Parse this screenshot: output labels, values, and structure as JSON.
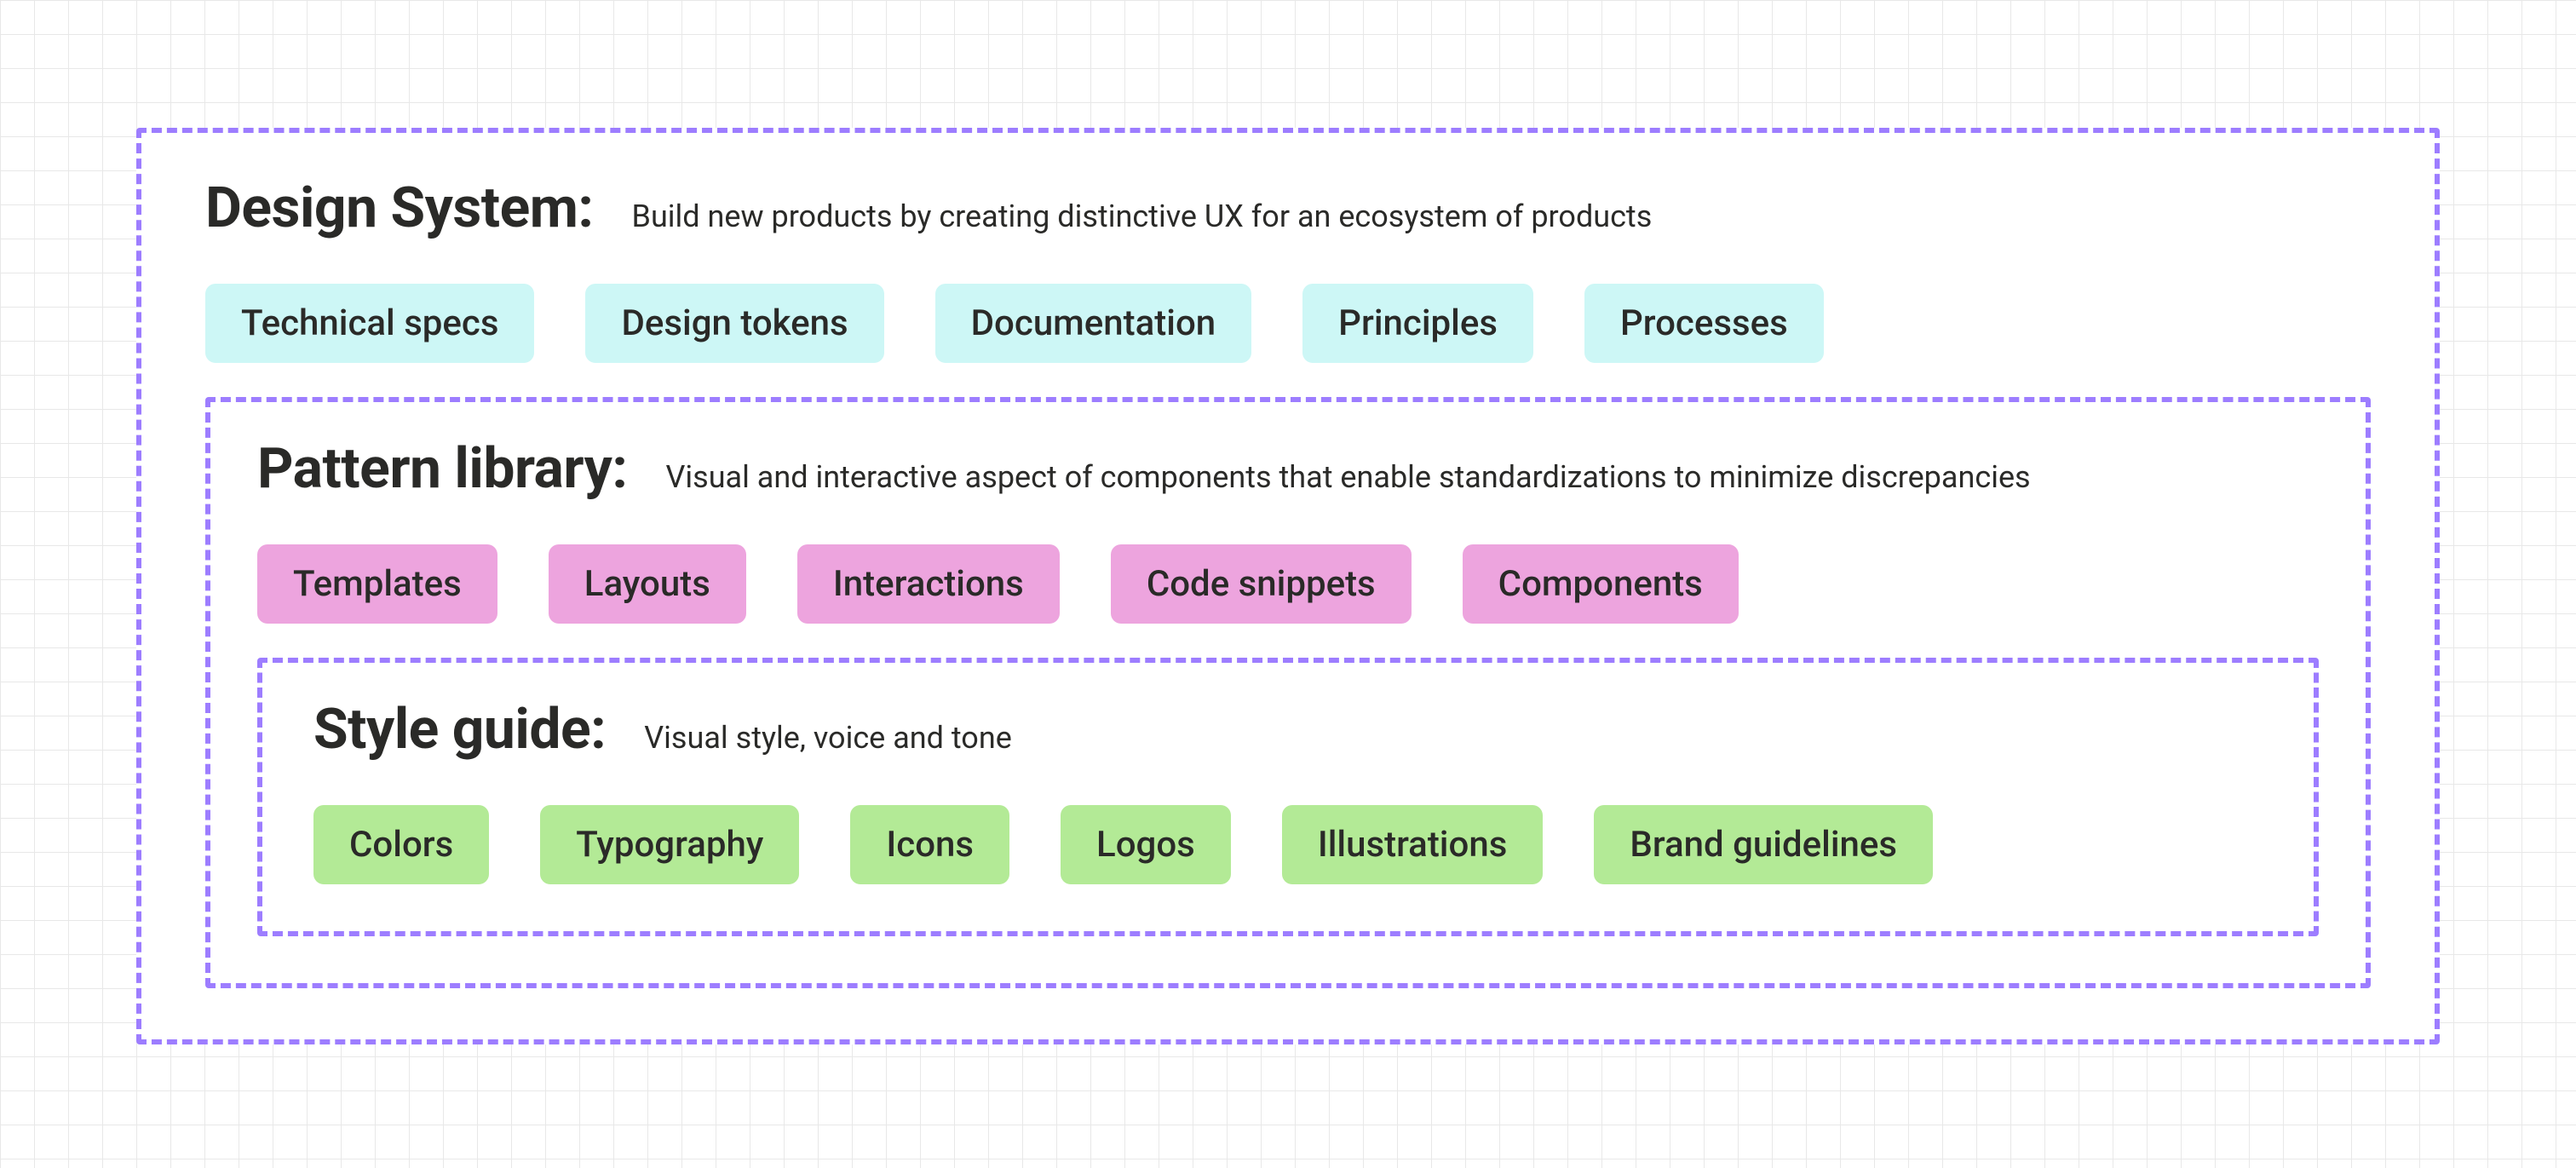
{
  "design_system": {
    "title": "Design System:",
    "description": "Build new products by creating distinctive UX for an ecosystem of products",
    "chips": [
      "Technical specs",
      "Design tokens",
      "Documentation",
      "Principles",
      "Processes"
    ]
  },
  "pattern_library": {
    "title": "Pattern library:",
    "description": "Visual and interactive aspect of components that enable standardizations to minimize discrepancies",
    "chips": [
      "Templates",
      "Layouts",
      "Interactions",
      "Code snippets",
      "Components"
    ]
  },
  "style_guide": {
    "title": "Style guide:",
    "description": "Visual style, voice and tone",
    "chips": [
      "Colors",
      "Typography",
      "Icons",
      "Logos",
      "Illustrations",
      "Brand guidelines"
    ]
  },
  "colors": {
    "dashed_border": "#9d7dff",
    "chip_cyan": "#cdf7f6",
    "chip_pink": "#eda4de",
    "chip_green": "#b3ea96",
    "text": "#2a2a28"
  }
}
